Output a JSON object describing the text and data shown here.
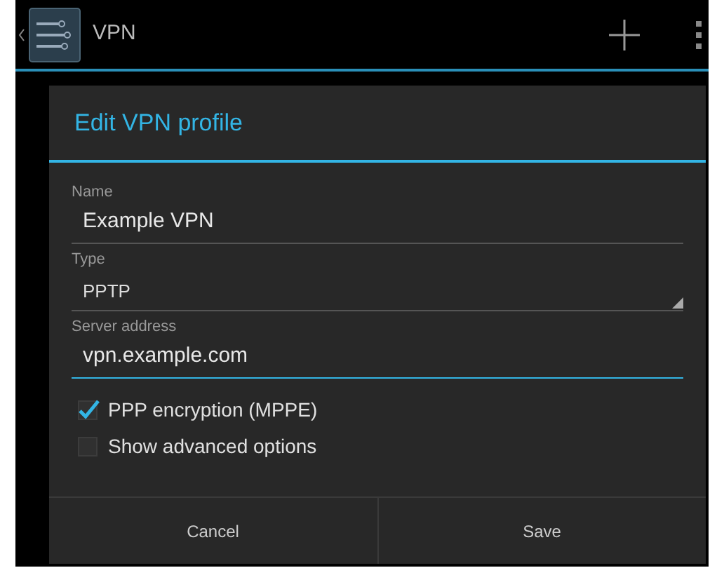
{
  "action_bar": {
    "title": "VPN"
  },
  "dialog": {
    "title": "Edit VPN profile",
    "fields": [
      {
        "kind": "text",
        "label": "Name",
        "value": "Example VPN",
        "focused": false
      },
      {
        "kind": "dropdown",
        "label": "Type",
        "value": "PPTP",
        "focused": false
      },
      {
        "kind": "text",
        "label": "Server address",
        "value": "vpn.example.com",
        "focused": true
      }
    ],
    "checkboxes": [
      {
        "label": "PPP encryption (MPPE)",
        "checked": true
      },
      {
        "label": "Show advanced options",
        "checked": false
      }
    ],
    "buttons": [
      "Cancel",
      "Save"
    ]
  }
}
